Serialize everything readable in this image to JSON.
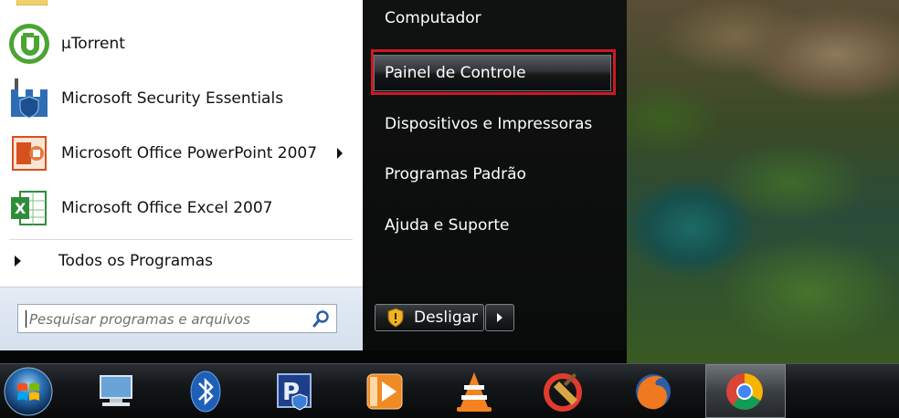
{
  "start_menu": {
    "programs": [
      {
        "label": "µTorrent",
        "icon": "utorrent-icon",
        "has_submenu": false
      },
      {
        "label": "Microsoft Security Essentials",
        "icon": "security-essentials-icon",
        "has_submenu": false
      },
      {
        "label": "Microsoft Office PowerPoint 2007",
        "icon": "powerpoint-icon",
        "has_submenu": true
      },
      {
        "label": "Microsoft Office Excel 2007",
        "icon": "excel-icon",
        "has_submenu": false
      }
    ],
    "all_programs_label": "Todos os Programas",
    "search": {
      "placeholder": "Pesquisar programas e arquivos",
      "value": ""
    },
    "right_items": [
      {
        "label": "Computador",
        "highlighted": false
      },
      {
        "label": "Painel de Controle",
        "highlighted": true
      },
      {
        "label": "Dispositivos e Impressoras",
        "highlighted": false
      },
      {
        "label": "Programas Padrão",
        "highlighted": false
      },
      {
        "label": "Ajuda e Suporte",
        "highlighted": false
      }
    ],
    "shutdown_label": "Desligar"
  },
  "taskbar": {
    "items": [
      {
        "icon": "windows-start-orb-icon"
      },
      {
        "icon": "computer-network-icon"
      },
      {
        "icon": "bluetooth-icon"
      },
      {
        "icon": "pdf-app-icon"
      },
      {
        "icon": "media-player-icon"
      },
      {
        "icon": "vlc-icon"
      },
      {
        "icon": "ccleaner-icon"
      },
      {
        "icon": "firefox-icon"
      },
      {
        "icon": "chrome-icon",
        "active": true
      }
    ]
  },
  "colors": {
    "highlight_outline": "#cc1a22",
    "menu_right_bg": "#0b0c0c",
    "search_area_bg": "#dbe5f0"
  }
}
